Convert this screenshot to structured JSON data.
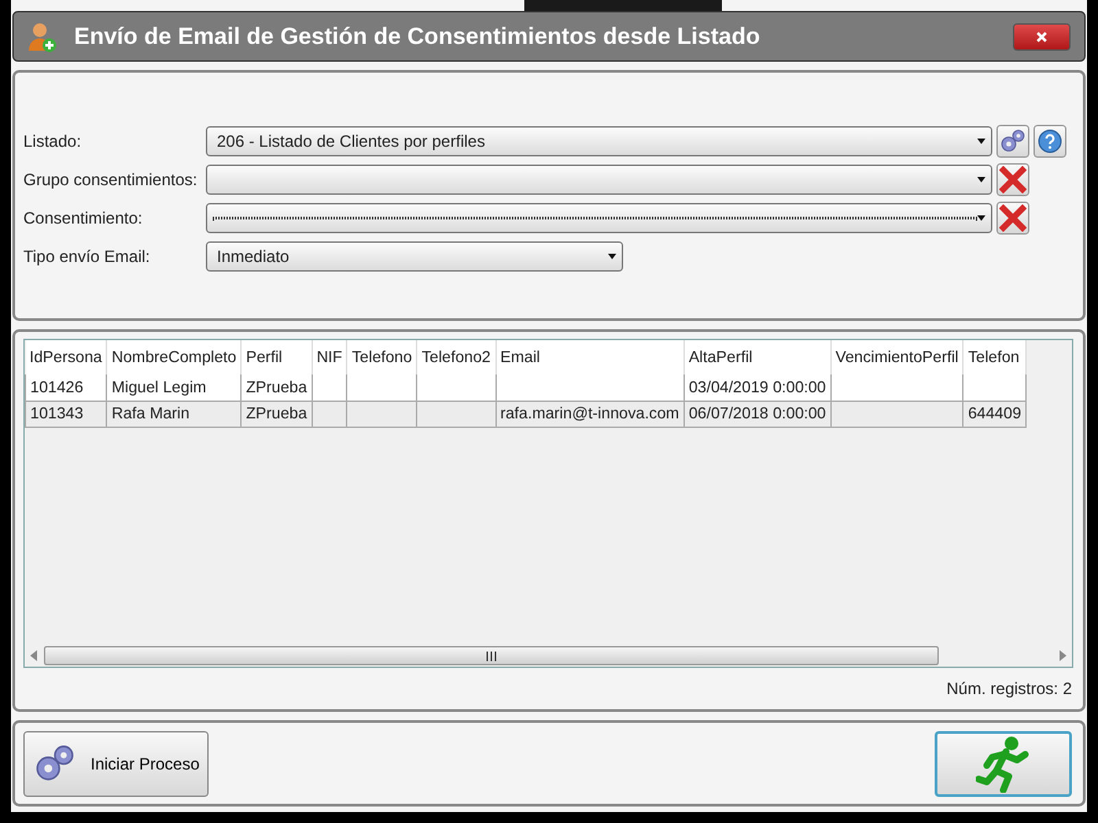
{
  "window": {
    "title": "Envío de Email de Gestión de Consentimientos desde Listado"
  },
  "form": {
    "fields": [
      {
        "label": "Listado:",
        "value": "206 - Listado de Clientes por perfiles",
        "wide": true,
        "focused": false,
        "actions": [
          {
            "kind": "gear"
          },
          {
            "kind": "help"
          }
        ]
      },
      {
        "label": "Grupo consentimientos:",
        "wide": true,
        "focused": false,
        "actions": [
          {
            "kind": "clear"
          }
        ]
      },
      {
        "label": "Consentimiento:",
        "wide": true,
        "focused": true,
        "actions": [
          {
            "kind": "clear"
          }
        ]
      },
      {
        "label": "Tipo envío Email:",
        "value": "Inmediato",
        "wide": false,
        "focused": false
      }
    ]
  },
  "table": {
    "columns": [
      "IdPersona",
      "NombreCompleto",
      "Perfil",
      "NIF",
      "Telefono",
      "Telefono2",
      "Email",
      "AltaPerfil",
      "VencimientoPerfil",
      "Telefon"
    ],
    "rows": [
      [
        "101426",
        "Miguel Legim",
        "ZPrueba",
        "",
        "",
        "",
        "",
        "03/04/2019 0:00:00",
        "",
        ""
      ],
      [
        "101343",
        "Rafa Marin",
        "ZPrueba",
        "",
        "",
        "",
        "rafa.marin@t-innova.com",
        "06/07/2018 0:00:00",
        "",
        "644409"
      ]
    ]
  },
  "record_count": "Núm. registros: 2",
  "buttons": [
    {
      "kind": "start",
      "label": "Iniciar Proceso"
    },
    {
      "kind": "run"
    }
  ]
}
